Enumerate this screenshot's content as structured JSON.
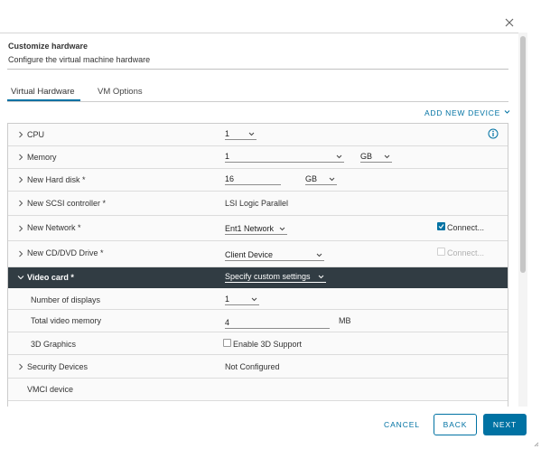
{
  "dialog": {
    "title": "Customize hardware",
    "subtitle": "Configure the virtual machine hardware"
  },
  "tabs": [
    {
      "label": "Virtual Hardware",
      "active": true
    },
    {
      "label": "VM Options",
      "active": false
    }
  ],
  "add_device_label": "ADD NEW DEVICE",
  "rows": {
    "cpu": {
      "label": "CPU",
      "value": "1"
    },
    "memory": {
      "label": "Memory",
      "value": "1",
      "unit": "GB"
    },
    "hard_disk": {
      "label": "New Hard disk *",
      "value": "16",
      "unit": "GB"
    },
    "scsi": {
      "label": "New SCSI controller *",
      "value": "LSI Logic Parallel"
    },
    "network": {
      "label": "New Network *",
      "value": "Ent1 Network",
      "connect_label": "Connect...",
      "connect_checked": true
    },
    "cdvd": {
      "label": "New CD/DVD Drive *",
      "value": "Client Device",
      "connect_label": "Connect...",
      "connect_checked": false
    },
    "video": {
      "label": "Video card *",
      "value": "Specify custom settings"
    },
    "displays": {
      "label": "Number of displays",
      "value": "1"
    },
    "video_memory": {
      "label": "Total video memory",
      "value": "4",
      "unit": "MB"
    },
    "graphics3d": {
      "label": "3D Graphics",
      "checkbox_label": "Enable 3D Support",
      "checked": false
    },
    "security": {
      "label": "Security Devices",
      "value": "Not Configured"
    },
    "vmci": {
      "label": "VMCI device"
    }
  },
  "footer": {
    "cancel": "CANCEL",
    "back": "BACK",
    "next": "NEXT"
  },
  "colors": {
    "accent": "#0072a3",
    "header_dark": "#313c43"
  }
}
